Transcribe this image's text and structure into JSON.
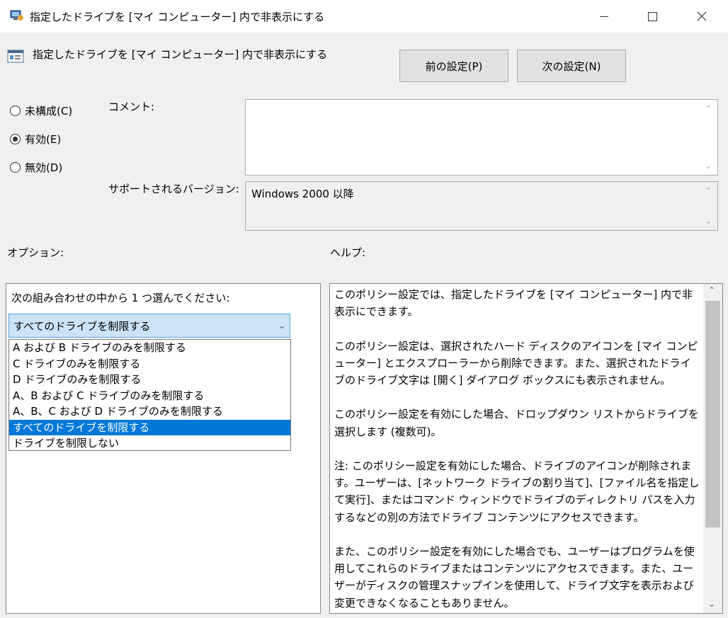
{
  "window": {
    "title": "指定したドライブを [マイ コンピューター] 内で非表示にする"
  },
  "header": {
    "policy_name": "指定したドライブを [マイ コンピューター] 内で非表示にする",
    "prev_button": "前の設定(P)",
    "next_button": "次の設定(N)"
  },
  "state": {
    "not_configured": "未構成(C)",
    "enabled": "有効(E)",
    "disabled": "無効(D)",
    "selected": "enabled"
  },
  "comment": {
    "label": "コメント:",
    "value": ""
  },
  "supported": {
    "label": "サポートされるバージョン:",
    "value": "Windows 2000 以降"
  },
  "options": {
    "label": "オプション:",
    "prompt": "次の組み合わせの中から 1 つ選んでください:",
    "selected_value": "すべてのドライブを制限する",
    "items": [
      "A および B ドライブのみを制限する",
      "C ドライブのみを制限する",
      "D ドライブのみを制限する",
      "A、B および C ドライブのみを制限する",
      "A、B、C および D ドライブのみを制限する",
      "すべてのドライブを制限する",
      "ドライブを制限しない"
    ],
    "highlighted_index": 5
  },
  "help": {
    "label": "ヘルプ:",
    "paragraphs": [
      "このポリシー設定では、指定したドライブを [マイ コンピューター] 内で非表示にできます。",
      "このポリシー設定は、選択されたハード ディスクのアイコンを [マイ コンピューター] とエクスプローラーから削除できます。また、選択されたドライブのドライブ文字は [開く] ダイアログ ボックスにも表示されません。",
      "このポリシー設定を有効にした場合、ドロップダウン リストからドライブを選択します (複数可)。",
      "注: このポリシー設定を有効にした場合、ドライブのアイコンが削除されます。ユーザーは、[ネットワーク ドライブの割り当て]、[ファイル名を指定して実行]、またはコマンド ウィンドウでドライブのディレクトリ パスを入力するなどの別の方法でドライブ コンテンツにアクセスできます。",
      "また、このポリシー設定を有効にした場合でも、ユーザーはプログラムを使用してこれらのドライブまたはコンテンツにアクセスできます。また、ユーザーがディスクの管理スナップインを使用して、ドライブ文字を表示および変更できなくなることもありません。"
    ]
  },
  "colors": {
    "selection": "#0078d7",
    "dropdown_bg": "#cce4f7",
    "window_bg": "#f0f0f0"
  }
}
